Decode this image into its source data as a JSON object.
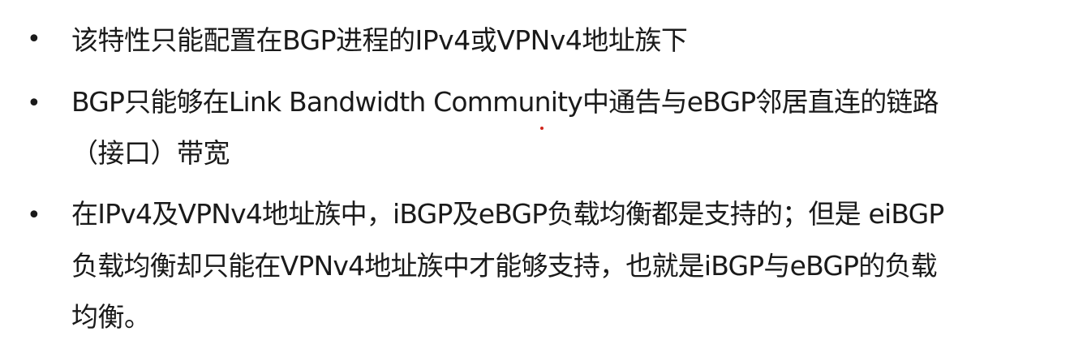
{
  "slide": {
    "bullet_glyph": "•",
    "items": [
      {
        "lines": [
          "该特性只能配置在BGP进程的IPv4或VPNv4地址族下"
        ]
      },
      {
        "lines": [
          "BGP只能够在Link Bandwidth Community中通告与eBGP邻居直连的链路",
          "（接口）带宽"
        ]
      },
      {
        "lines": [
          "在IPv4及VPNv4地址族中，iBGP及eBGP负载均衡都是支持的；但是 eiBGP",
          "负载均衡却只能在VPNv4地址族中才能够支持，也就是iBGP与eBGP的负载",
          "均衡。"
        ]
      }
    ],
    "colors": {
      "text": "#1a1a1a",
      "background": "#ffffff",
      "marker": "#d0261d"
    }
  }
}
